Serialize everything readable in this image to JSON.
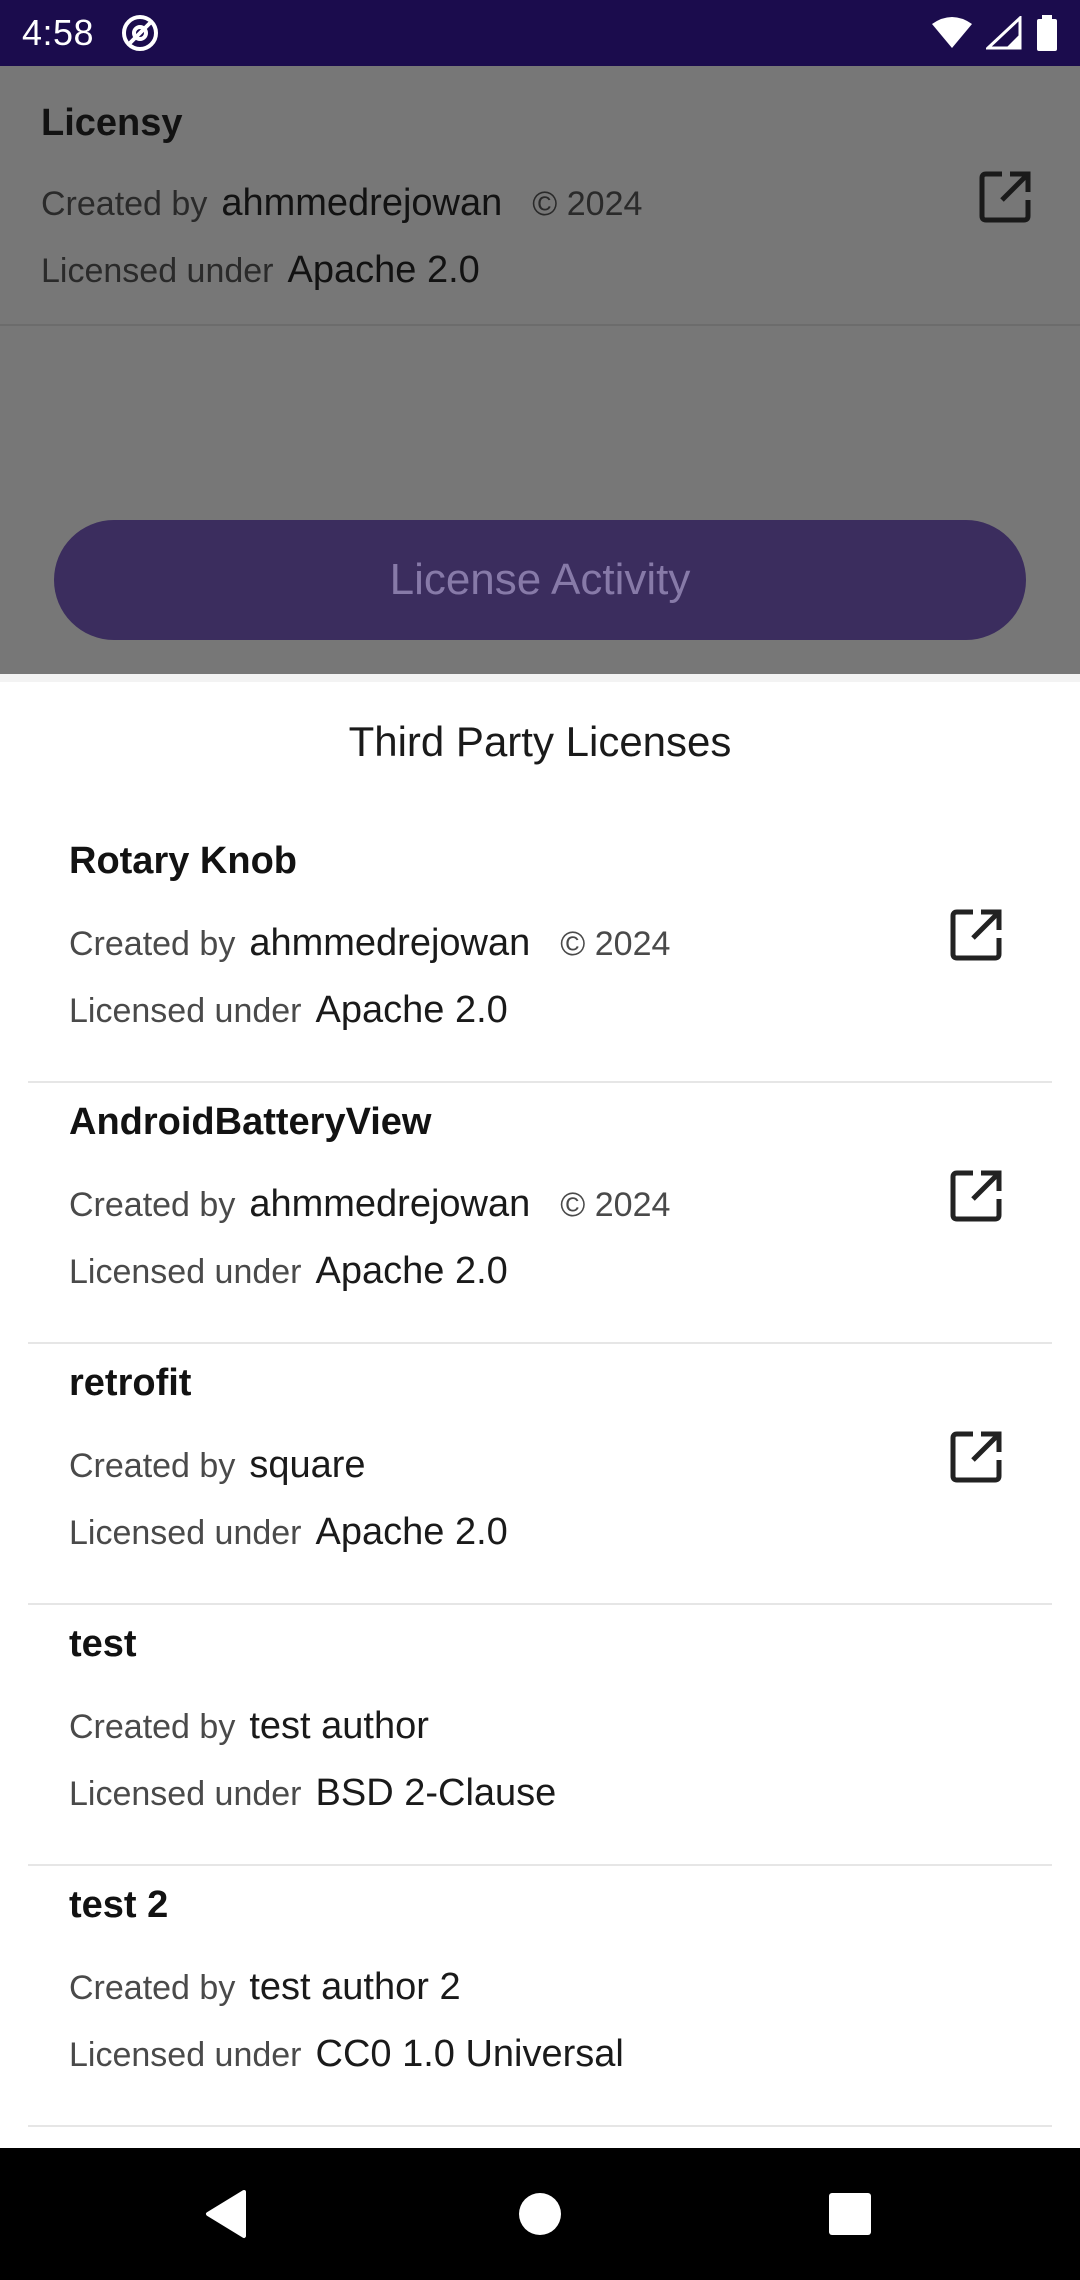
{
  "status_bar": {
    "time": "4:58",
    "at_icon": "at-sign-icon",
    "wifi_icon": "wifi-icon",
    "signal_icon": "signal-icon",
    "battery_icon": "battery-icon"
  },
  "background": {
    "item": {
      "name": "Licensy",
      "created_by_label": "Created by",
      "author": "ahmmedrejowan",
      "copyright": "© 2024",
      "licensed_under_label": "Licensed under",
      "license": "Apache 2.0"
    },
    "button_label": "License Activity"
  },
  "sheet": {
    "title": "Third Party Licenses",
    "items": [
      {
        "name": "Rotary Knob",
        "created_by_label": "Created by",
        "author": "ahmmedrejowan",
        "copyright": "© 2024",
        "licensed_under_label": "Licensed under",
        "license": "Apache 2.0",
        "has_link": true
      },
      {
        "name": "AndroidBatteryView",
        "created_by_label": "Created by",
        "author": "ahmmedrejowan",
        "copyright": "© 2024",
        "licensed_under_label": "Licensed under",
        "license": "Apache 2.0",
        "has_link": true
      },
      {
        "name": "retrofit",
        "created_by_label": "Created by",
        "author": "square",
        "copyright": "",
        "licensed_under_label": "Licensed under",
        "license": "Apache 2.0",
        "has_link": true
      },
      {
        "name": "test",
        "created_by_label": "Created by",
        "author": "test author",
        "copyright": "",
        "licensed_under_label": "Licensed under",
        "license": "BSD 2-Clause",
        "has_link": false
      },
      {
        "name": "test 2",
        "created_by_label": "Created by",
        "author": "test author 2",
        "copyright": "",
        "licensed_under_label": "Licensed under",
        "license": "CC0 1.0 Universal",
        "has_link": false
      }
    ]
  },
  "nav_bar": {
    "back_icon": "back-triangle-icon",
    "home_icon": "home-circle-icon",
    "recents_icon": "recents-square-icon"
  },
  "colors": {
    "status_bar": "#1b0c4d",
    "scrim": "#777777",
    "button_bg": "#3b2d5e",
    "button_text": "#877aa8"
  }
}
